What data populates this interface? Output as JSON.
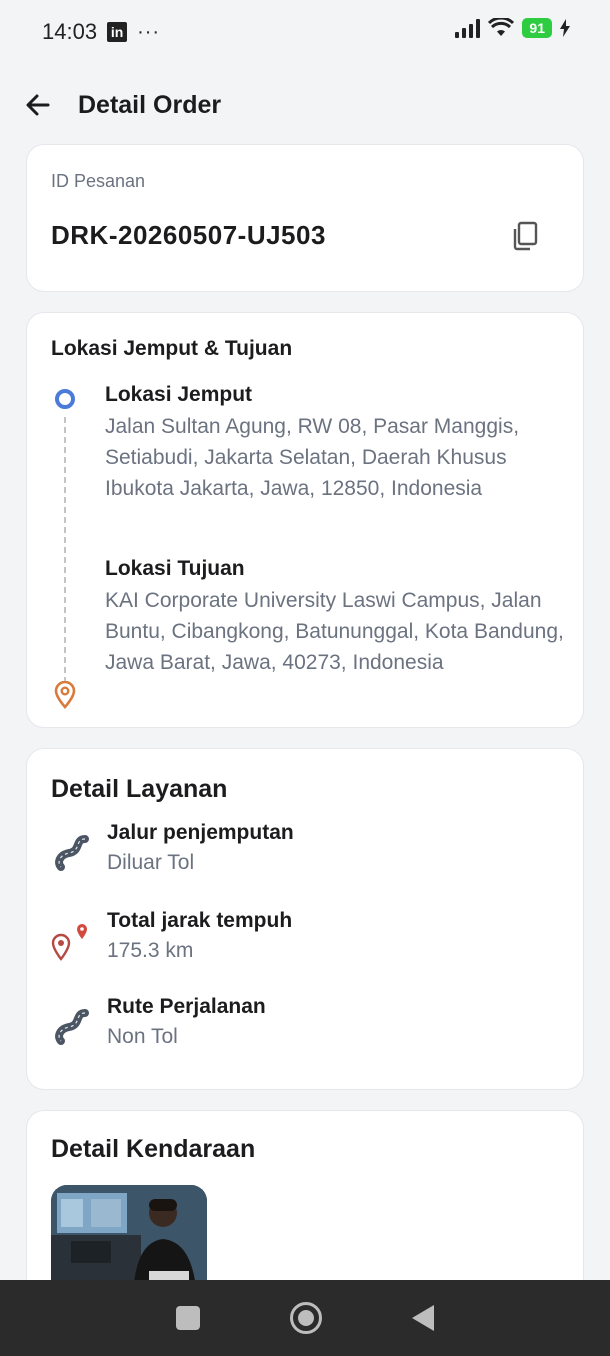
{
  "status_bar": {
    "time": "14:03",
    "app_badge": "in",
    "more": "···",
    "battery": "91"
  },
  "header": {
    "title": "Detail Order"
  },
  "order": {
    "id_label": "ID Pesanan",
    "id_value": "DRK-20260507-UJ503"
  },
  "location": {
    "section_title": "Lokasi Jemput & Tujuan",
    "pickup_title": "Lokasi Jemput",
    "pickup_address": "Jalan Sultan Agung, RW 08, Pasar Manggis, Setiabudi, Jakarta Selatan, Daerah Khusus Ibukota Jakarta, Jawa, 12850, Indonesia",
    "dest_title": "Lokasi Tujuan",
    "dest_address": "KAI Corporate University Laswi Campus, Jalan Buntu, Cibangkong, Batununggal, Kota Bandung, Jawa Barat, Jawa, 40273, Indonesia"
  },
  "service": {
    "section_title": "Detail Layanan",
    "items": [
      {
        "label": "Jalur penjemputan",
        "value": "Diluar Tol",
        "icon": "road-icon"
      },
      {
        "label": "Total jarak tempuh",
        "value": "175.3 km",
        "icon": "map-pins-icon"
      },
      {
        "label": "Rute Perjalanan",
        "value": "Non Tol",
        "icon": "road-icon"
      }
    ]
  },
  "vehicle": {
    "section_title": "Detail Kendaraan"
  },
  "colors": {
    "pickup_pin": "#4a7bd8",
    "dest_pin": "#d9793a",
    "battery": "#2ecc40"
  }
}
